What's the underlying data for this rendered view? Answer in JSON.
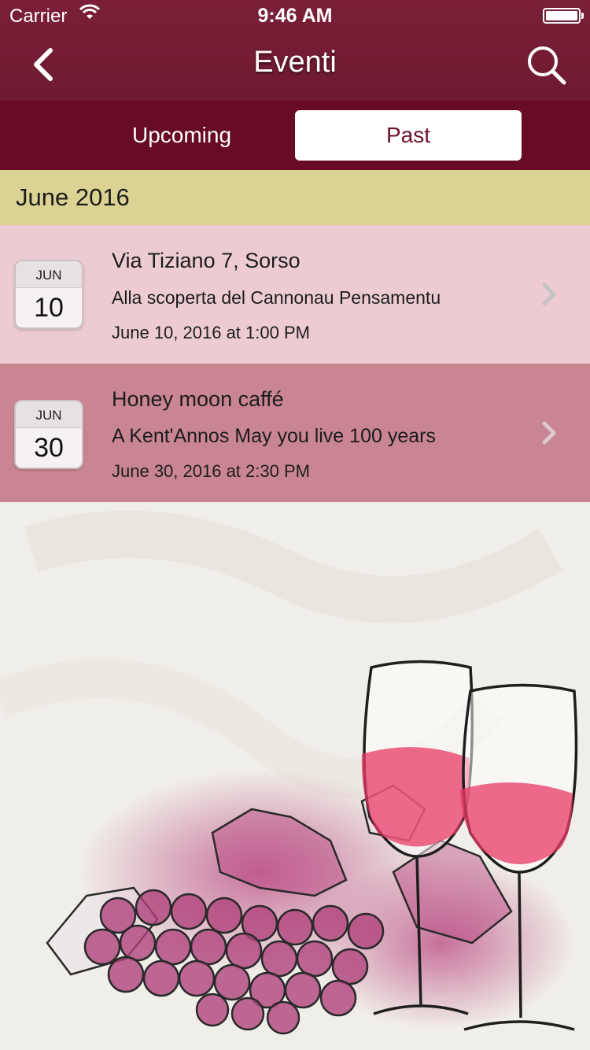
{
  "status_bar": {
    "carrier": "Carrier",
    "time": "9:46 AM"
  },
  "nav": {
    "title": "Eventi",
    "back_icon": "chevron-left-icon",
    "search_icon": "search-icon"
  },
  "segments": {
    "upcoming": "Upcoming",
    "past": "Past",
    "selected": "Past"
  },
  "section": {
    "title": "June 2016"
  },
  "events": [
    {
      "month": "JUN",
      "day": "10",
      "location": "Via Tiziano 7, Sorso",
      "title": "Alla scoperta del Cannonau Pensamentu",
      "datetime": "June 10, 2016 at 1:00 PM"
    },
    {
      "month": "JUN",
      "day": "30",
      "location": "Honey moon caffé",
      "title": "A Kent'Annos May you live 100 years",
      "datetime": "June 30, 2016 at 2:30 PM"
    }
  ],
  "colors": {
    "nav_bg": "#7a1f36",
    "segment_bg": "#680b26",
    "section_bg": "#dcd294",
    "row1_bg": "#eccbd3",
    "row2_bg": "#c98592",
    "wine": "#e83a66"
  }
}
